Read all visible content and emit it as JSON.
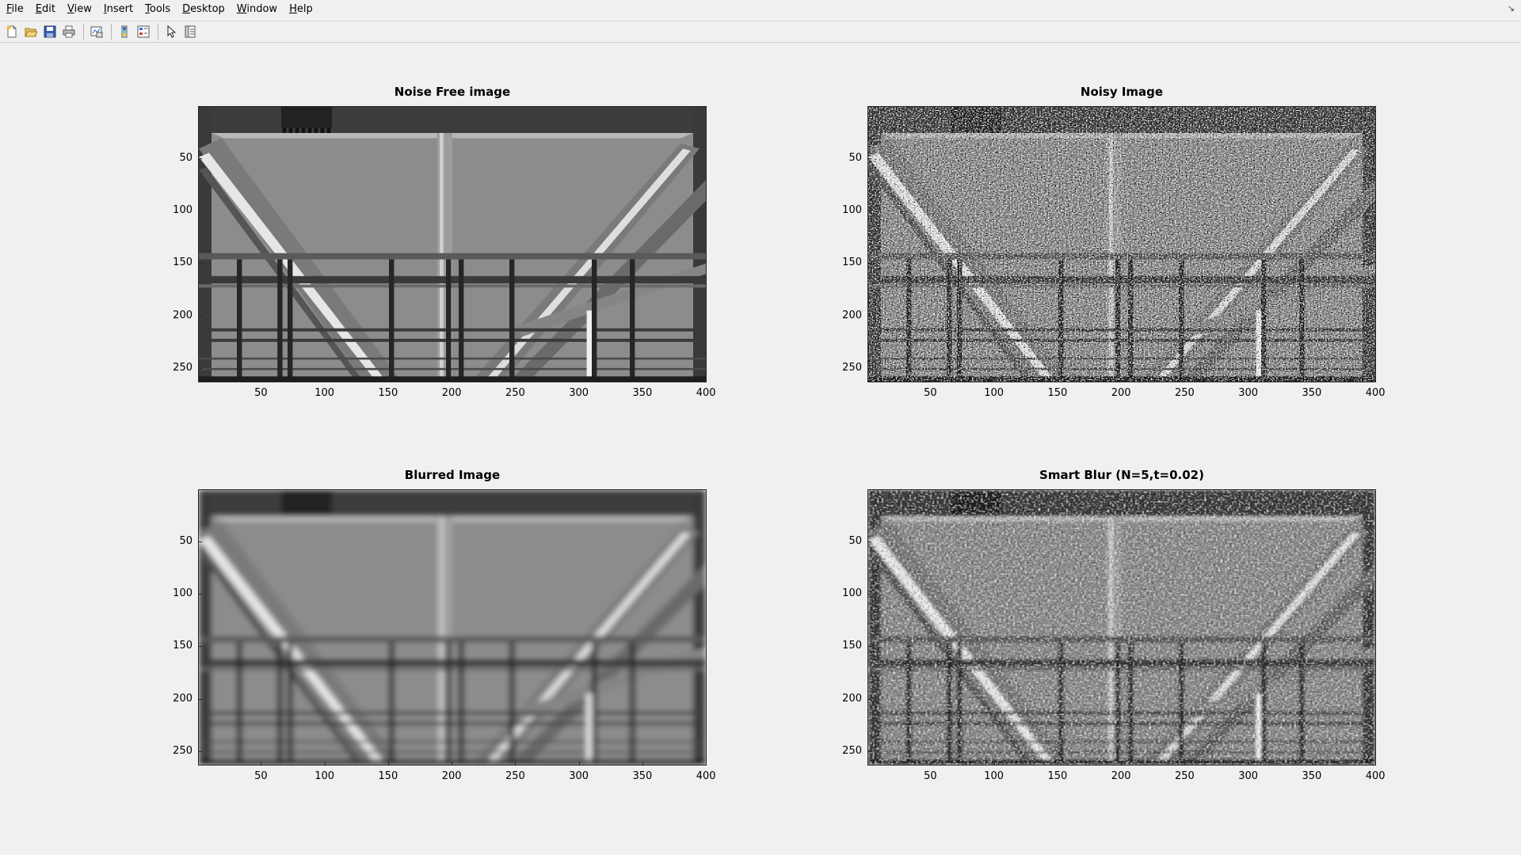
{
  "menu": {
    "items": [
      {
        "label": "File",
        "accel": "F",
        "rest": "ile"
      },
      {
        "label": "Edit",
        "accel": "E",
        "rest": "dit"
      },
      {
        "label": "View",
        "accel": "V",
        "rest": "iew"
      },
      {
        "label": "Insert",
        "accel": "I",
        "rest": "nsert"
      },
      {
        "label": "Tools",
        "accel": "T",
        "rest": "ools"
      },
      {
        "label": "Desktop",
        "accel": "D",
        "rest": "esktop"
      },
      {
        "label": "Window",
        "accel": "W",
        "rest": "indow"
      },
      {
        "label": "Help",
        "accel": "H",
        "rest": "elp"
      }
    ]
  },
  "toolbar": {
    "icons": [
      "new-figure-icon",
      "open-file-icon",
      "save-icon",
      "print-icon",
      "link-plot-icon",
      "colorbar-icon",
      "legend-icon",
      "edit-plot-icon",
      "property-inspector-icon"
    ]
  },
  "axes": [
    {
      "title": "Noise Free image",
      "variant": "clean"
    },
    {
      "title": "Noisy Image",
      "variant": "noisy"
    },
    {
      "title": "Blurred Image",
      "variant": "blur"
    },
    {
      "title": "Smart Blur (N=5,t=0.02)",
      "variant": "smart"
    }
  ],
  "xticks": [
    "50",
    "100",
    "150",
    "200",
    "250",
    "300",
    "350",
    "400"
  ],
  "yticks": [
    "50",
    "100",
    "150",
    "200",
    "250"
  ],
  "image_size": {
    "width": 400,
    "height": 263
  }
}
